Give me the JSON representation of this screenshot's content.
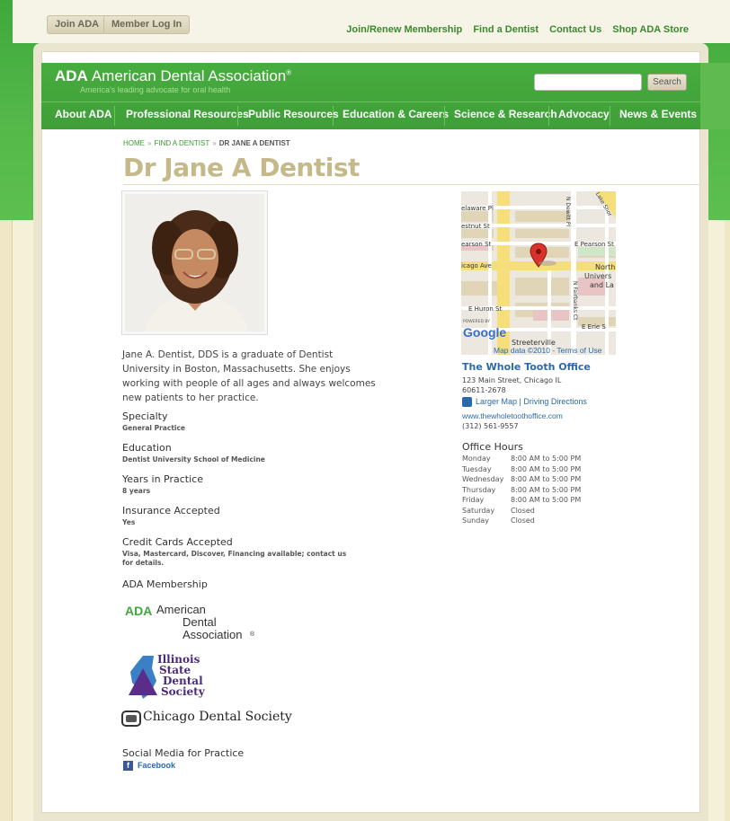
{
  "topbar": {
    "join_label": "Join ADA",
    "login_label": "Member Log In",
    "links": [
      "Join/Renew Membership",
      "Find a Dentist",
      "Contact Us",
      "Shop ADA Store"
    ]
  },
  "header": {
    "logo_abbr": "ADA",
    "logo_name": "American Dental Association",
    "logo_mark": "®",
    "tagline": "America's leading advocate for oral health",
    "search_placeholder": "",
    "search_label": "Search"
  },
  "nav": [
    "About ADA",
    "Professional Resources",
    "Public Resources",
    "Education & Careers",
    "Science & Research",
    "Advocacy",
    "News & Events"
  ],
  "breadcrumb": {
    "items": [
      "HOME",
      "FIND A DENTIST"
    ],
    "separator": "»",
    "current": "DR JANE A DENTIST"
  },
  "profile": {
    "name": "Dr Jane A Dentist",
    "bio": "Jane A. Dentist, DDS is a graduate of Dentist University in Boston, Massachusetts. She enjoys working with people of all ages and always welcomes new patients to her practice.",
    "specialty_label": "Specialty",
    "specialty": "General Practice",
    "education_label": "Education",
    "education": "Dentist University School of Medicine",
    "years_label": "Years in Practice",
    "years": "8 years",
    "insurance_label": "Insurance Accepted",
    "insurance": "Yes",
    "cards_label": "Credit Cards Accepted",
    "cards_line1": "Visa, Mastercard, Discover, Financing available; contact us",
    "cards_line2": "for details.",
    "membership_label": "ADA Membership",
    "social_label": "Social Media for Practice",
    "facebook_label": "Facebook"
  },
  "membership": {
    "ada_abbr": "ADA",
    "ada_line1": "American",
    "ada_line2": "Dental",
    "ada_line3": "Association",
    "ada_mark": "®",
    "isds_line1": "Illinois",
    "isds_line2": "State",
    "isds_line3": "Dental",
    "isds_line4": "Society",
    "cds_name": "Chicago Dental Society"
  },
  "map": {
    "streets": {
      "delaware": "elaware Pl",
      "chestnut": "estnut St",
      "pearson_w": "earson St",
      "pearson_e": "E Pearson St",
      "chicago": "icago Ave",
      "north1": "North",
      "north2": "Univers",
      "north3": "and La",
      "huron": "E Huron St",
      "erie": "E Erie S",
      "dewitt": "N Dewitt Pl",
      "fairbanks": "N Fairbanks Ct",
      "lake_shore": "Lake Shor",
      "streeterville": "Streeterville"
    },
    "powered_by": "POWERED BY",
    "google": "Google",
    "credits": "Map data ©2010 - Terms of Use"
  },
  "office": {
    "name": "The Whole Tooth Office",
    "street": "123 Main Street, Chicago IL",
    "zip": "60611-2678",
    "map_links": "Larger Map | Driving Directions",
    "website": "www.thewholetoothoffice.com",
    "phone": "(312) 561-9557",
    "hours_title": "Office Hours",
    "hours": [
      {
        "day": "Monday",
        "time": "8:00 AM to 5:00 PM"
      },
      {
        "day": "Tuesday",
        "time": "8:00 AM to 5:00 PM"
      },
      {
        "day": "Wednesday",
        "time": "8:00 AM to 5:00 PM"
      },
      {
        "day": "Thursday",
        "time": "8:00 AM to 5:00 PM"
      },
      {
        "day": "Friday",
        "time": "8:00 AM to 5:00 PM"
      },
      {
        "day": "Saturday",
        "time": "Closed"
      },
      {
        "day": "Sunday",
        "time": "Closed"
      }
    ]
  },
  "colors": {
    "brand_green": "#47ad3f",
    "title_tan": "#c5b98a",
    "link_blue": "#2a6aa8"
  }
}
